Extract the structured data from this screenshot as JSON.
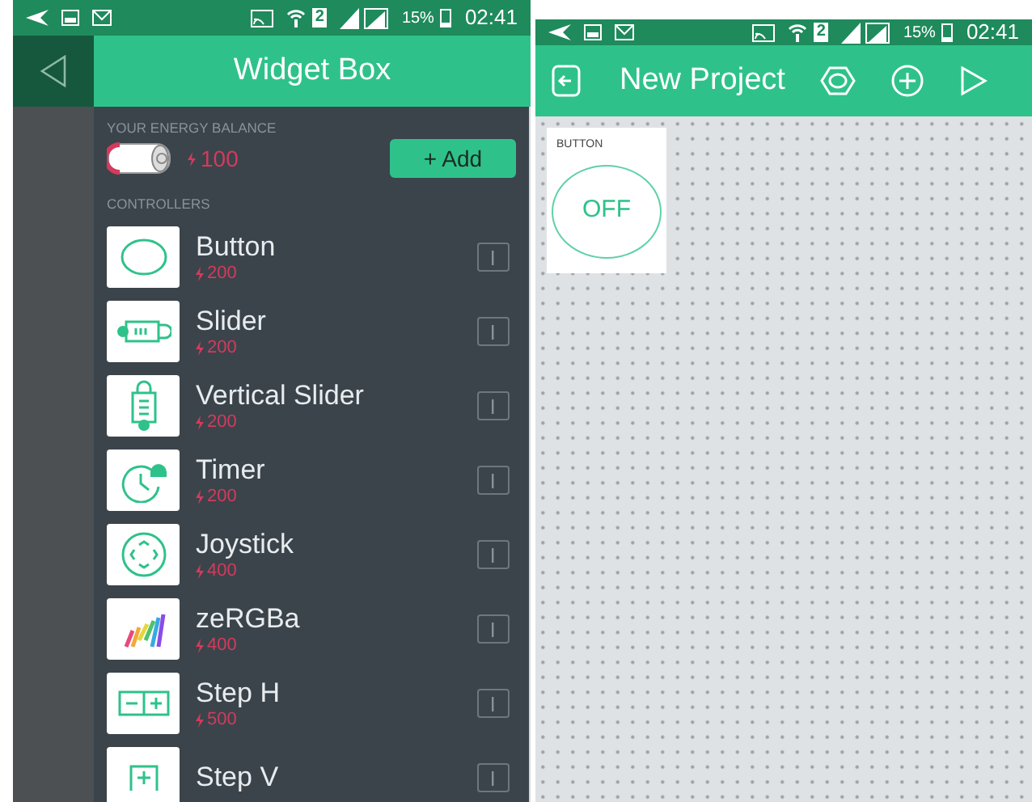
{
  "left_screen": {
    "status_bar": {
      "sim": "2",
      "battery": "15%",
      "time": "02:41"
    },
    "header": {
      "title": "Widget Box"
    },
    "energy": {
      "label": "YOUR ENERGY BALANCE",
      "amount": "100",
      "add_button": "+ Add"
    },
    "section": "CONTROLLERS",
    "widgets": [
      {
        "kind": "button",
        "name": "Button",
        "price": "200"
      },
      {
        "kind": "slider",
        "name": "Slider",
        "price": "200"
      },
      {
        "kind": "vslider",
        "name": "Vertical Slider",
        "price": "200"
      },
      {
        "kind": "timer",
        "name": "Timer",
        "price": "200"
      },
      {
        "kind": "joystick",
        "name": "Joystick",
        "price": "400"
      },
      {
        "kind": "zergba",
        "name": "zeRGBa",
        "price": "400"
      },
      {
        "kind": "steph",
        "name": "Step H",
        "price": "500"
      },
      {
        "kind": "stepv",
        "name": "Step V"
      }
    ]
  },
  "right_screen": {
    "status_bar": {
      "sim": "2",
      "battery": "15%",
      "time": "02:41"
    },
    "header": {
      "title": "New Project"
    },
    "canvas": {
      "widget": {
        "label": "BUTTON",
        "value": "OFF"
      }
    }
  }
}
